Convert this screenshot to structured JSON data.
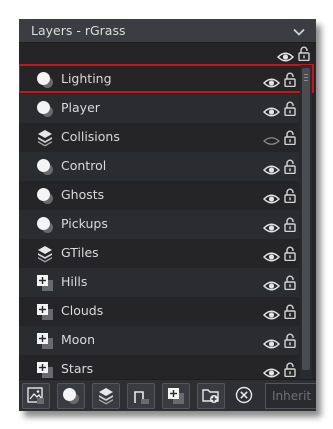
{
  "panel": {
    "title": "Layers - rGrass",
    "collapse_icon": "chevron-down-icon"
  },
  "layers": [
    {
      "name": "Lighting",
      "type": "instance",
      "visible": true,
      "selected": true
    },
    {
      "name": "Player",
      "type": "instance",
      "visible": true,
      "selected": false
    },
    {
      "name": "Collisions",
      "type": "tile",
      "visible": false,
      "selected": false
    },
    {
      "name": "Control",
      "type": "instance",
      "visible": true,
      "selected": false
    },
    {
      "name": "Ghosts",
      "type": "instance",
      "visible": true,
      "selected": false
    },
    {
      "name": "Pickups",
      "type": "instance",
      "visible": true,
      "selected": false
    },
    {
      "name": "GTiles",
      "type": "tile",
      "visible": true,
      "selected": false
    },
    {
      "name": "Hills",
      "type": "background",
      "visible": true,
      "selected": false
    },
    {
      "name": "Clouds",
      "type": "background",
      "visible": true,
      "selected": false
    },
    {
      "name": "Moon",
      "type": "background",
      "visible": true,
      "selected": false
    },
    {
      "name": "Stars",
      "type": "background",
      "visible": true,
      "selected": false
    }
  ],
  "toolbar": {
    "buttons": [
      "add-background-layer-icon",
      "add-instance-layer-icon",
      "add-tile-layer-icon",
      "add-path-layer-icon",
      "add-asset-layer-icon",
      "add-folder-icon",
      "delete-layer-icon"
    ],
    "inherit_label": "Inherit"
  },
  "colors": {
    "panel_bg": "#252527",
    "titlebar_bg": "#3b3d42",
    "text": "#dadada",
    "selection_outline": "#c8151b"
  }
}
